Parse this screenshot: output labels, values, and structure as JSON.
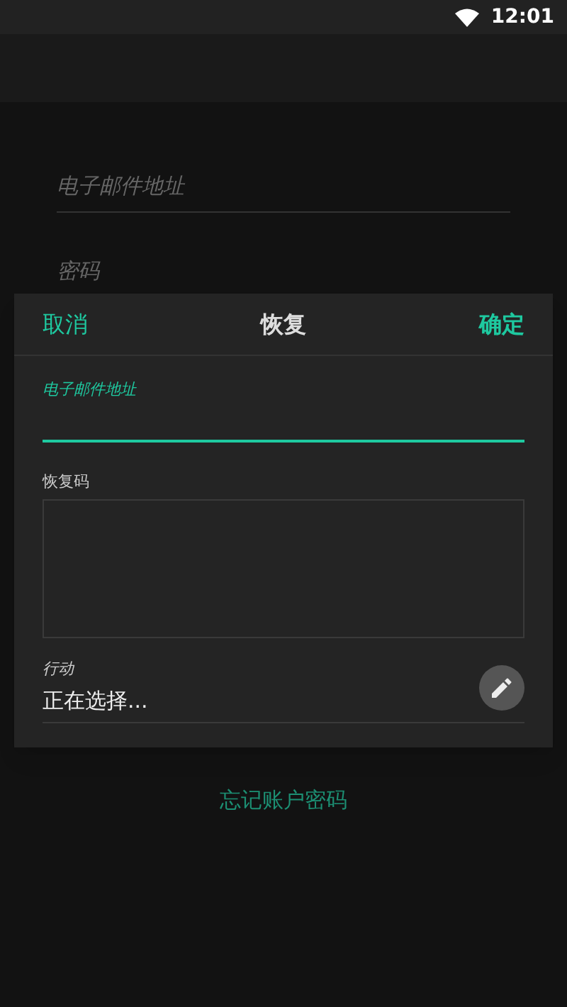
{
  "status_bar": {
    "time": "12:01"
  },
  "login_form": {
    "email": {
      "placeholder": "电子邮件地址"
    },
    "password": {
      "placeholder": "密码"
    },
    "forgot_link": "忘记账户密码"
  },
  "dialog": {
    "cancel": "取消",
    "title": "恢复",
    "confirm": "确定",
    "email": {
      "label": "电子邮件地址",
      "focused": true
    },
    "recovery_code": {
      "label": "恢复码"
    },
    "action": {
      "label": "行动",
      "value": "正在选择..."
    }
  }
}
